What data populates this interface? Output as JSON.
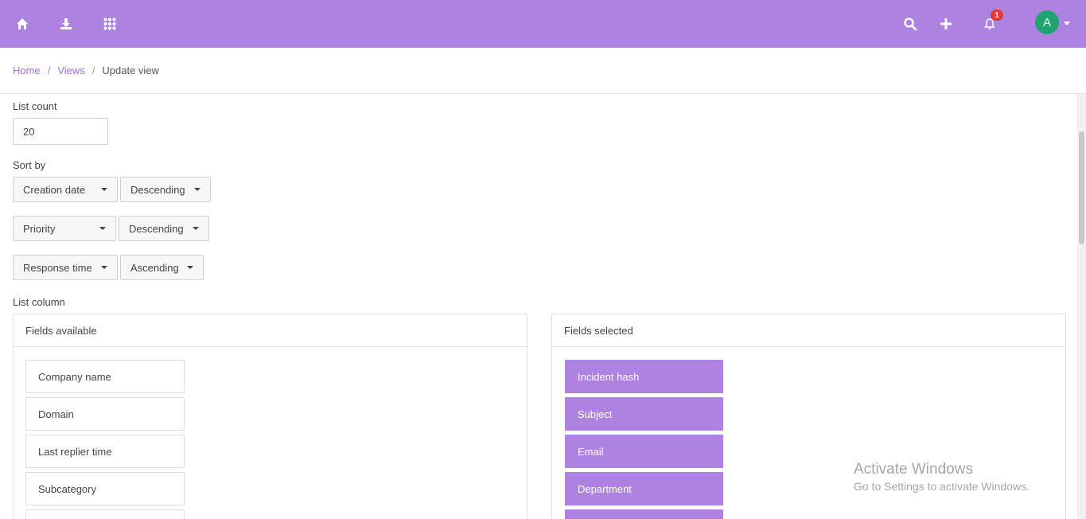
{
  "topbar": {
    "color": "#ae82e0",
    "icons": {
      "home": "home-icon",
      "download": "download-icon",
      "apps": "apps-grid-icon",
      "search": "search-icon",
      "add": "plus-icon",
      "notifications": "bell-icon"
    },
    "notification_count": "1",
    "avatar_initial": "A",
    "avatar_color": "#1fa36f"
  },
  "breadcrumb": {
    "home": "Home",
    "views": "Views",
    "current": "Update view",
    "separator": "/"
  },
  "form": {
    "list_count_label": "List count",
    "list_count_value": "20",
    "sort_by_label": "Sort by",
    "sorts": [
      {
        "field": "Creation date",
        "order": "Descending"
      },
      {
        "field": "Priority",
        "order": "Descending"
      },
      {
        "field": "Response time",
        "order": "Ascending"
      }
    ],
    "list_column_label": "List column"
  },
  "fields_available": {
    "title": "Fields available",
    "items": [
      "Company name",
      "Domain",
      "Last replier time",
      "Subcategory"
    ]
  },
  "fields_selected": {
    "title": "Fields selected",
    "items": [
      "Incident hash",
      "Subject",
      "Email",
      "Department"
    ]
  },
  "watermark": {
    "title": "Activate Windows",
    "subtitle": "Go to Settings to activate Windows."
  }
}
